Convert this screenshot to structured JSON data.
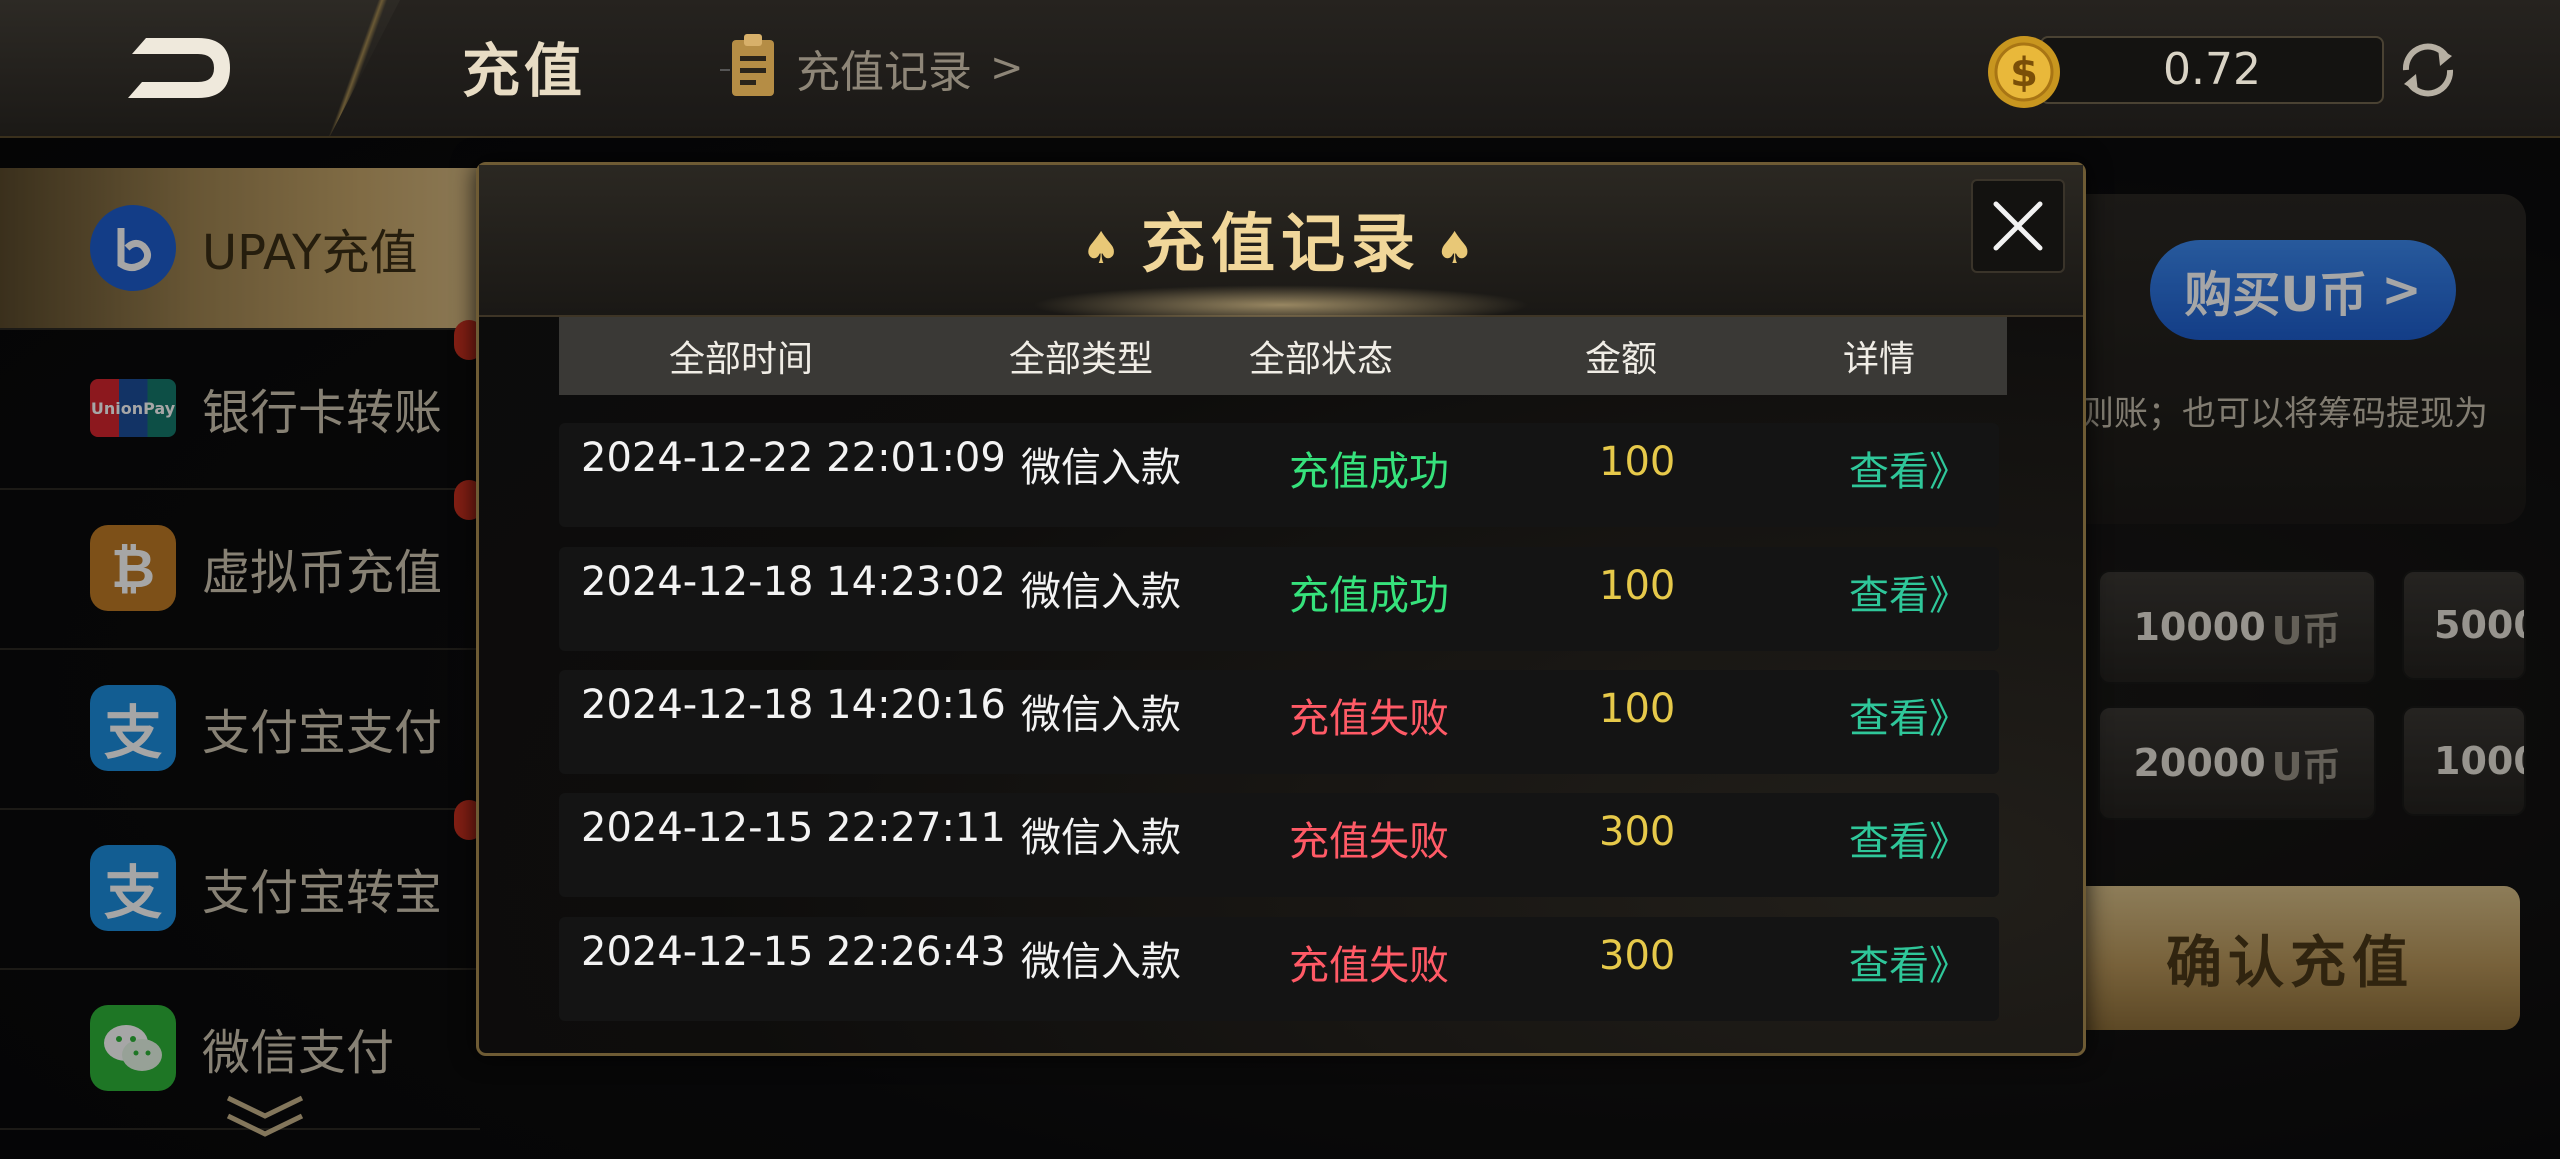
{
  "header": {
    "title": "充值",
    "records_link": "充值记录",
    "records_chevron": ">",
    "balance": "0.72"
  },
  "sidebar": {
    "items": [
      {
        "label": "UPAY充值",
        "icon": "upay-icon",
        "active": true
      },
      {
        "label": "银行卡转账",
        "icon": "unionpay-icon"
      },
      {
        "label": "虚拟币充值",
        "icon": "bitcoin-icon"
      },
      {
        "label": "支付宝支付",
        "icon": "alipay-icon"
      },
      {
        "label": "支付宝转宝",
        "icon": "alipay-icon"
      },
      {
        "label": "微信支付",
        "icon": "wechat-icon"
      }
    ]
  },
  "main": {
    "buy_u_label": "购买U币",
    "buy_u_chevron": ">",
    "notice": "则账；也可以将筹码提现为",
    "amounts": [
      {
        "value": "10000",
        "unit": "U币"
      },
      {
        "value": "5000"
      },
      {
        "value": "20000",
        "unit": "U币"
      },
      {
        "value": "1000"
      }
    ],
    "confirm_label": "确认充值"
  },
  "modal": {
    "title": "充值记录",
    "spade": "♠",
    "columns": [
      "全部时间",
      "全部类型",
      "全部状态",
      "金额",
      "详情"
    ],
    "rows": [
      {
        "time": "2024-12-22 22:01:09",
        "type": "微信入款",
        "status": "充值成功",
        "status_kind": "ok",
        "amount": "100",
        "detail": "查看》"
      },
      {
        "time": "2024-12-18 14:23:02",
        "type": "微信入款",
        "status": "充值成功",
        "status_kind": "ok",
        "amount": "100",
        "detail": "查看》"
      },
      {
        "time": "2024-12-18 14:20:16",
        "type": "微信入款",
        "status": "充值失败",
        "status_kind": "fail",
        "amount": "100",
        "detail": "查看》"
      },
      {
        "time": "2024-12-15 22:27:11",
        "type": "微信入款",
        "status": "充值失败",
        "status_kind": "fail",
        "amount": "300",
        "detail": "查看》"
      },
      {
        "time": "2024-12-15 22:26:43",
        "type": "微信入款",
        "status": "充值失败",
        "status_kind": "fail",
        "amount": "300",
        "detail": "查看》"
      }
    ]
  },
  "colors": {
    "accent_gold": "#f1d79a",
    "status_ok": "#36e27c",
    "status_fail": "#ff5a66",
    "amount": "#e6c94a",
    "detail_link": "#2fc79a",
    "buy_button": "#2b74e4"
  }
}
